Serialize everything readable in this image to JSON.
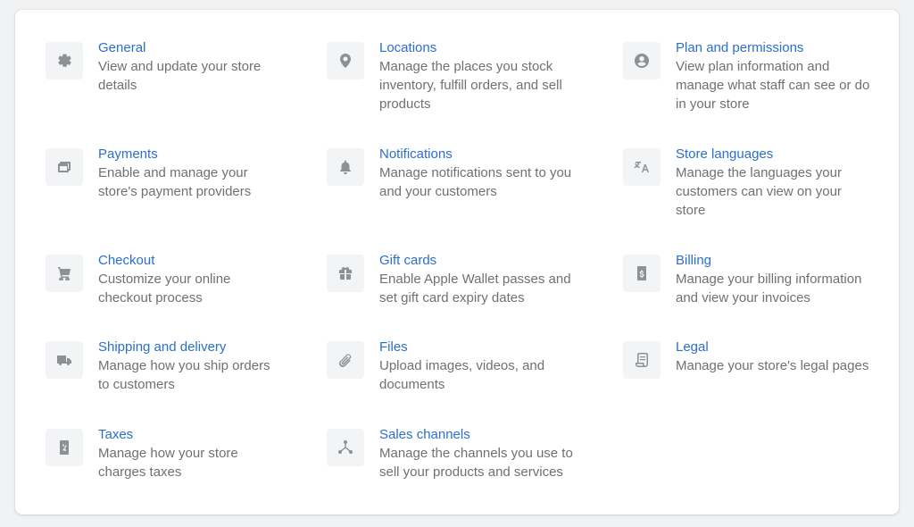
{
  "settings": {
    "items": [
      {
        "icon": "gear-icon",
        "title": "General",
        "description": "View and update your store details"
      },
      {
        "icon": "location-pin-icon",
        "title": "Locations",
        "description": "Manage the places you stock inventory, fulfill orders, and sell products"
      },
      {
        "icon": "user-circle-icon",
        "title": "Plan and permissions",
        "description": "View plan information and manage what staff can see or do in your store"
      },
      {
        "icon": "credit-card-icon",
        "title": "Payments",
        "description": "Enable and manage your store's payment providers"
      },
      {
        "icon": "bell-icon",
        "title": "Notifications",
        "description": "Manage notifications sent to you and your customers"
      },
      {
        "icon": "translate-icon",
        "title": "Store languages",
        "description": "Manage the languages your customers can view on your store"
      },
      {
        "icon": "cart-icon",
        "title": "Checkout",
        "description": "Customize your online checkout process"
      },
      {
        "icon": "gift-icon",
        "title": "Gift cards",
        "description": "Enable Apple Wallet passes and set gift card expiry dates"
      },
      {
        "icon": "billing-icon",
        "title": "Billing",
        "description": "Manage your billing information and view your invoices"
      },
      {
        "icon": "truck-icon",
        "title": "Shipping and delivery",
        "description": "Manage how you ship orders to customers"
      },
      {
        "icon": "paperclip-icon",
        "title": "Files",
        "description": "Upload images, videos, and documents"
      },
      {
        "icon": "legal-document-icon",
        "title": "Legal",
        "description": "Manage your store's legal pages"
      },
      {
        "icon": "tax-icon",
        "title": "Taxes",
        "description": "Manage how your store charges taxes"
      },
      {
        "icon": "channels-icon",
        "title": "Sales channels",
        "description": "Manage the channels you use to sell your products and services"
      }
    ]
  }
}
